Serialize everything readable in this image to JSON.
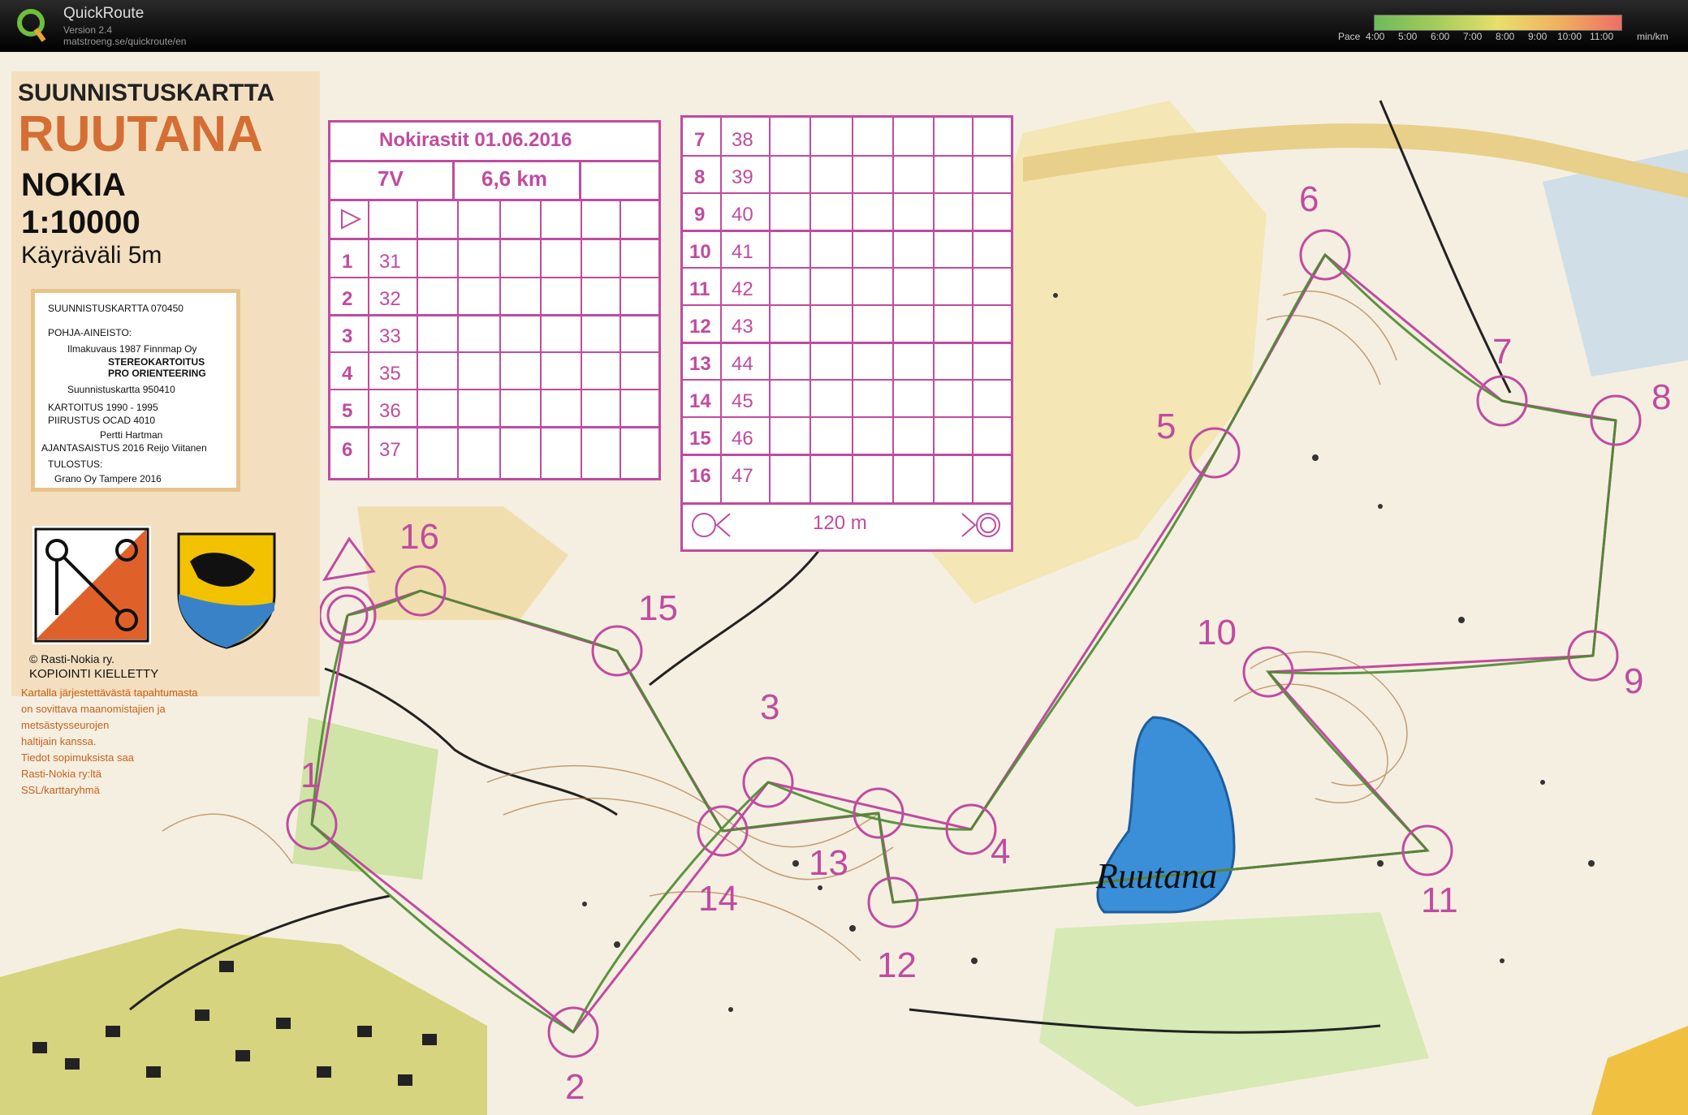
{
  "app": {
    "title": "QuickRoute",
    "version": "Version 2.4",
    "url": "matstroeng.se/quickroute/en",
    "pace": {
      "label": "Pace",
      "ticks": [
        "4:00",
        "5:00",
        "6:00",
        "7:00",
        "8:00",
        "9:00",
        "10:00",
        "11:00"
      ],
      "unit": "min/km"
    }
  },
  "map": {
    "title_line1": "SUUNNISTUSKARTTA",
    "title_line2": "RUUTANA",
    "location": "NOKIA",
    "scale": "1:10000",
    "contour": "Käyräväli 5m",
    "lake_name": "Ruutana",
    "info": {
      "line1": "SUUNNISTUSKARTTA  070450",
      "line2": "POHJA-AINEISTO:",
      "line3": "Ilmakuvaus 1987 Finnmap Oy",
      "line4": "STEREOKARTOITUS",
      "line5": "PRO ORIENTEERING",
      "line6": "Suunnistuskartta 950410",
      "line7": "KARTOITUS 1990 - 1995",
      "line8": "PIIRUSTUS  OCAD 4010",
      "line9": "Pertti Hartman",
      "line10": "AJANTASAISTUS 2016 Reijo Viitanen",
      "line11": "TULOSTUS:",
      "line12": "Grano Oy Tampere 2016"
    },
    "copyright": "© Rasti-Nokia ry.",
    "copy_notice": "KOPIOINTI KIELLETTY",
    "usage_lines": [
      "Kartalla järjestettävästä tapahtumasta",
      "on sovittava maanomistajien ja",
      "metsästysseurojen",
      "haltijain kanssa.",
      "Tiedot sopimuksista saa",
      "Rasti-Nokia ry:ltä",
      "SSL/karttaryhmä"
    ]
  },
  "course": {
    "event": "Nokirastit 01.06.2016",
    "class": "7V",
    "length": "6,6 km",
    "finish_distance": "120 m",
    "controls_left": [
      {
        "num": "1",
        "code": "31"
      },
      {
        "num": "2",
        "code": "32"
      },
      {
        "num": "3",
        "code": "33"
      },
      {
        "num": "4",
        "code": "35"
      },
      {
        "num": "5",
        "code": "36"
      },
      {
        "num": "6",
        "code": "37"
      }
    ],
    "controls_right": [
      {
        "num": "7",
        "code": "38"
      },
      {
        "num": "8",
        "code": "39"
      },
      {
        "num": "9",
        "code": "40"
      },
      {
        "num": "10",
        "code": "41"
      },
      {
        "num": "11",
        "code": "42"
      },
      {
        "num": "12",
        "code": "43"
      },
      {
        "num": "13",
        "code": "44"
      },
      {
        "num": "14",
        "code": "45"
      },
      {
        "num": "15",
        "code": "46"
      },
      {
        "num": "16",
        "code": "47"
      }
    ],
    "map_labels": [
      "1",
      "2",
      "3",
      "4",
      "5",
      "6",
      "7",
      "8",
      "9",
      "10",
      "11",
      "12",
      "13",
      "14",
      "15",
      "16"
    ]
  },
  "colors": {
    "course": "#c04ba0",
    "route": "#4a8a2e",
    "lake": "#3a8fd8",
    "legend_orange": "#d46e34"
  }
}
